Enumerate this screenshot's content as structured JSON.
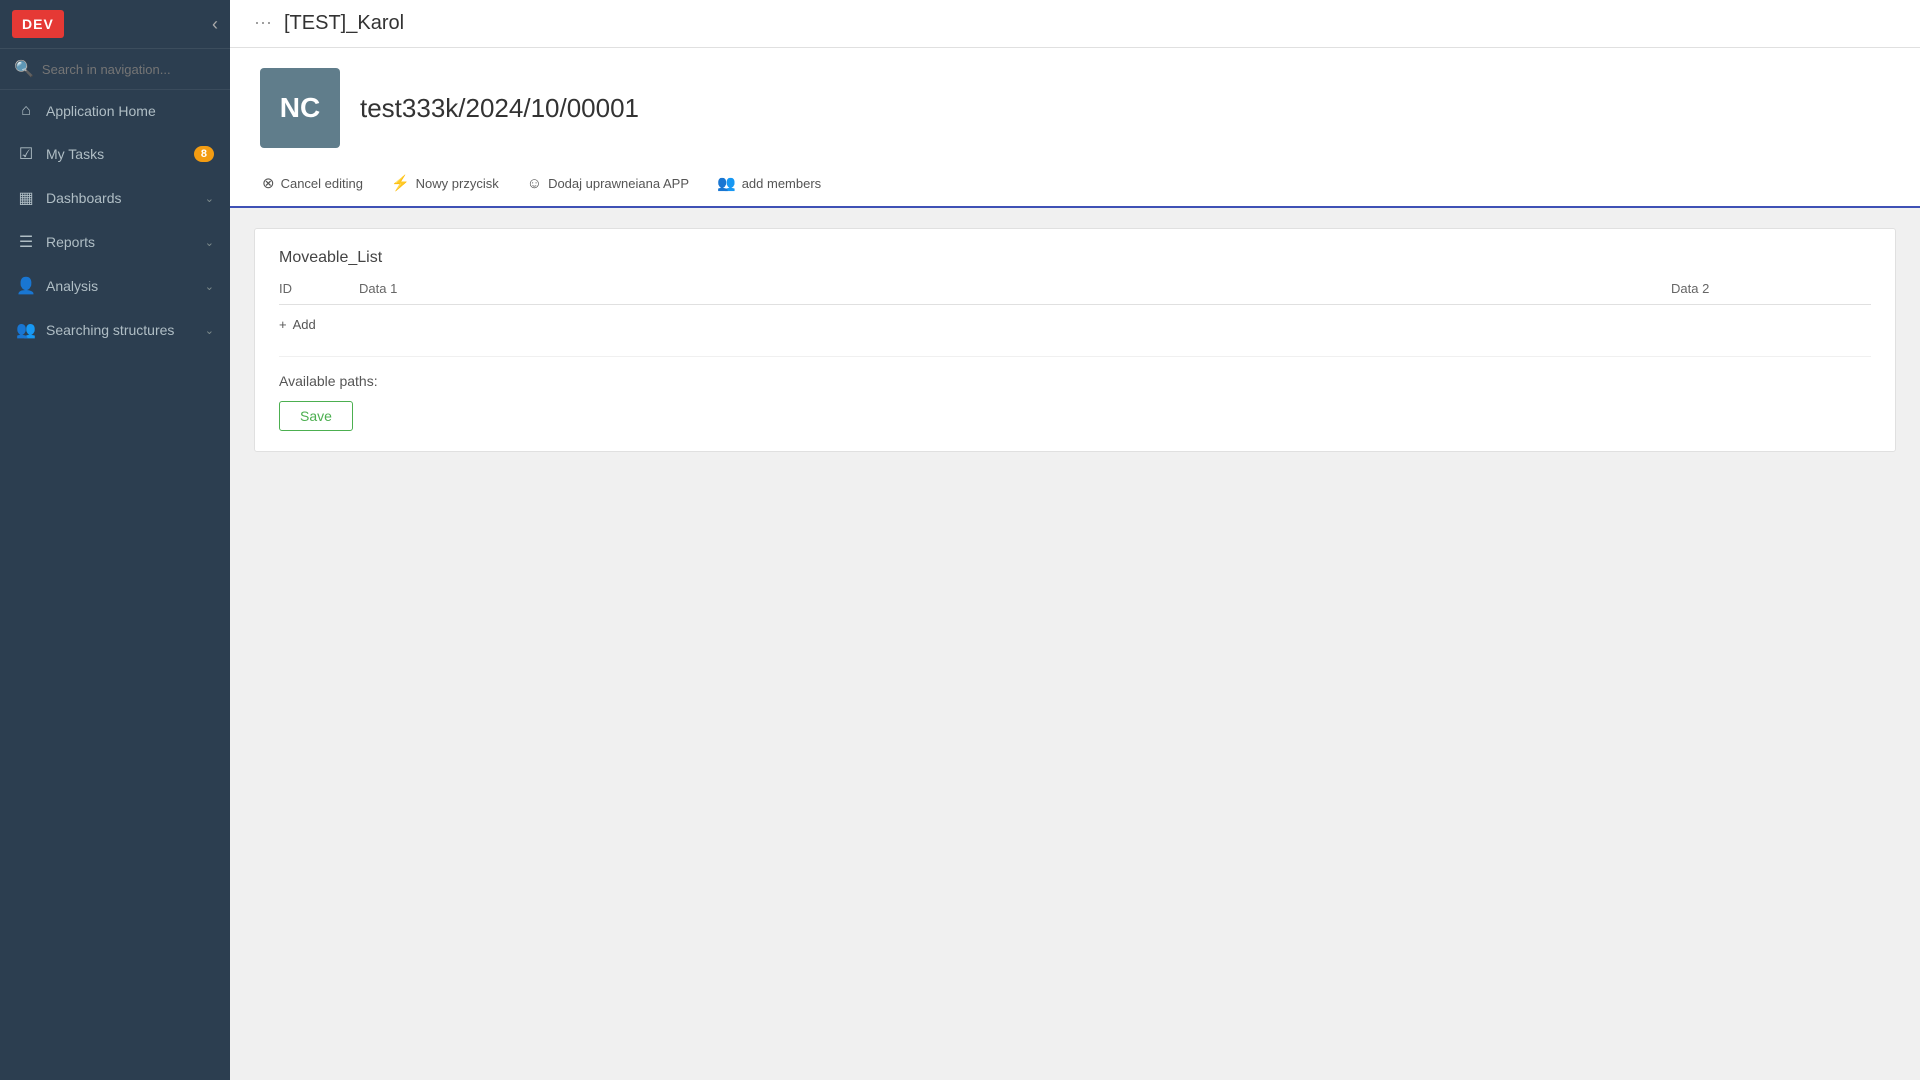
{
  "sidebar": {
    "dev_badge": "DEV",
    "search_placeholder": "Search in navigation...",
    "items": [
      {
        "id": "application-home",
        "icon": "⌂",
        "label": "Application Home",
        "badge": null,
        "chevron": false
      },
      {
        "id": "my-tasks",
        "icon": "☑",
        "label": "My Tasks",
        "badge": "8",
        "chevron": false
      },
      {
        "id": "dashboards",
        "icon": "▦",
        "label": "Dashboards",
        "badge": null,
        "chevron": true
      },
      {
        "id": "reports",
        "icon": "≡",
        "label": "Reports",
        "badge": null,
        "chevron": true
      },
      {
        "id": "analysis",
        "icon": "👤",
        "label": "Analysis",
        "badge": null,
        "chevron": true
      },
      {
        "id": "searching-structures",
        "icon": "👤",
        "label": "Searching structures",
        "badge": null,
        "chevron": true
      }
    ]
  },
  "topbar": {
    "app_name": "[TEST]_Karol",
    "grid_icon": "⠿"
  },
  "record": {
    "avatar_text": "NC",
    "record_id": "test333k/2024/10/00001",
    "actions": [
      {
        "id": "cancel-editing",
        "icon": "⊗",
        "label": "Cancel editing"
      },
      {
        "id": "nowy-przycisk",
        "icon": "⚡",
        "label": "Nowy przycisk"
      },
      {
        "id": "dodaj-uprawneiana",
        "icon": "☺",
        "label": "Dodaj uprawneiana APP"
      },
      {
        "id": "add-members",
        "icon": "👤+",
        "label": "add members"
      }
    ]
  },
  "moveable_list": {
    "section_title": "Moveable_List",
    "columns": [
      {
        "id": "col-id",
        "label": "ID"
      },
      {
        "id": "col-data1",
        "label": "Data 1"
      },
      {
        "id": "col-data2",
        "label": "Data 2"
      }
    ],
    "add_label": "Add"
  },
  "paths_section": {
    "label": "Available paths:",
    "save_label": "Save"
  }
}
